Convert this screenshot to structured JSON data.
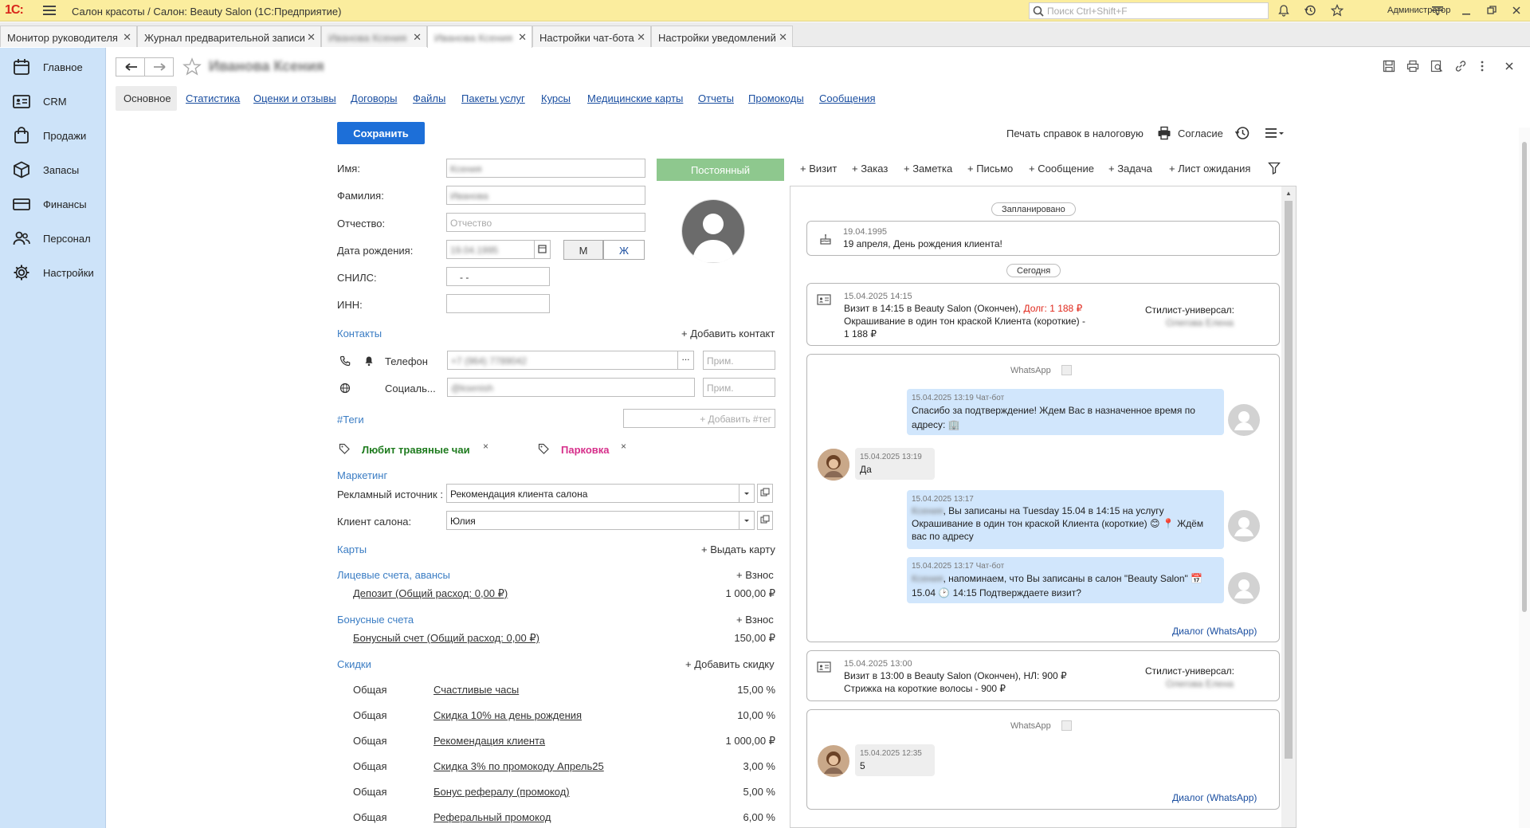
{
  "window": {
    "logo": "1С:",
    "title": "Салон красоты / Салон: Beauty Salon  (1С:Предприятие)",
    "search_placeholder": "Поиск Ctrl+Shift+F",
    "user": "Администратор"
  },
  "tabs": [
    {
      "label": "Монитор руководителя"
    },
    {
      "label": "Журнал предварительной записи"
    },
    {
      "label": "Иванова Ксения"
    },
    {
      "label": "Иванова Ксения"
    },
    {
      "label": "Настройки чат-бота"
    },
    {
      "label": "Настройки уведомлений"
    }
  ],
  "sidebar": {
    "items": [
      {
        "label": "Главное",
        "icon": "calendar-icon"
      },
      {
        "label": "CRM",
        "icon": "contact-card-icon"
      },
      {
        "label": "Продажи",
        "icon": "shopping-bag-icon"
      },
      {
        "label": "Запасы",
        "icon": "box-icon"
      },
      {
        "label": "Финансы",
        "icon": "wallet-icon"
      },
      {
        "label": "Персонал",
        "icon": "people-icon"
      },
      {
        "label": "Настройки",
        "icon": "gear-icon"
      }
    ]
  },
  "form": {
    "title": "Иванова Ксения",
    "subtabs": [
      "Основное",
      "Статистика",
      "Оценки и отзывы",
      "Договоры",
      "Файлы",
      "Пакеты услуг",
      "Курсы",
      "Медицинские карты",
      "Отчеты",
      "Промокоды",
      "Сообщения"
    ],
    "save_label": "Сохранить",
    "status_button": "Постоянный",
    "fields": {
      "name_label": "Имя:",
      "name_value": "Ксения",
      "surname_label": "Фамилия:",
      "surname_value": "Иванова",
      "patronymic_label": "Отчество:",
      "patronymic_placeholder": "Отчество",
      "birth_label": "Дата рождения:",
      "birth_value": "19.04.1995",
      "gender_m": "М",
      "gender_f": "Ж",
      "snils_label": "СНИЛС:",
      "snils_value": "-   -",
      "inn_label": "ИНН:"
    },
    "contacts": {
      "title": "Контакты",
      "add": "+ Добавить контакт",
      "phone_label": "Телефон",
      "phone_value": "+7 (964) 7789042",
      "social_label": "Социаль...",
      "social_value": "@ksenish",
      "note_placeholder": "Прим.",
      "more": "..."
    },
    "tags": {
      "title": "#Теги",
      "add_placeholder": "+ Добавить #тег",
      "items": [
        {
          "label": "Любит травяные чаи",
          "color": "#1e7b1e"
        },
        {
          "label": "Парковка",
          "color": "#d62e8a"
        }
      ],
      "remove": "×"
    },
    "marketing": {
      "title": "Маркетинг",
      "source_label": "Рекламный источник :",
      "source_value": "Рекомендация клиента салона",
      "client_label": "Клиент салона:",
      "client_value": "Юлия"
    },
    "cards": {
      "title": "Карты",
      "add": "+ Выдать карту"
    },
    "accounts": {
      "title": "Лицевые счета, авансы",
      "add": "+ Взнос",
      "item": "Депозит  (Общий расход: 0,00 ₽)",
      "value": "1 000,00 ₽"
    },
    "bonus": {
      "title": "Бонусные счета",
      "add": "+ Взнос",
      "item": "Бонусный счет   (Общий расход: 0,00 ₽)",
      "value": "150,00 ₽"
    },
    "discounts": {
      "title": "Скидки",
      "add": "+ Добавить скидку",
      "rows": [
        {
          "type": "Общая",
          "name": "Счастливые часы",
          "value": "15,00 %"
        },
        {
          "type": "Общая",
          "name": "Скидка 10% на день рождения",
          "value": "10,00 %"
        },
        {
          "type": "Общая",
          "name": "Рекомендация клиента",
          "value": "1 000,00 ₽"
        },
        {
          "type": "Общая",
          "name": "Скидка 3% по промокоду Апрель25",
          "value": "3,00 %"
        },
        {
          "type": "Общая",
          "name": "Бонус рефералу (промокод)",
          "value": "5,00 %"
        },
        {
          "type": "Общая",
          "name": "Реферальный промокод",
          "value": "6,00 %"
        }
      ]
    }
  },
  "right": {
    "print_tax": "Печать справок в налоговую",
    "consent": "Согласие",
    "actions": [
      "+ Визит",
      "+ Заказ",
      "+ Заметка",
      "+ Письмо",
      "+ Сообщение",
      "+ Задача",
      "+ Лист ожидания"
    ],
    "feed": {
      "planned": "Запланировано",
      "today": "Сегодня",
      "birthday": {
        "date": "19.04.1995",
        "text": "19 апреля, День рождения клиента!"
      },
      "visit1": {
        "datetime": "15.04.2025 14:15",
        "line1": "Визит в 14:15 в Beauty Salon (Окончен), ",
        "debt": "Долг:  1 188 ₽",
        "line2": "Окрашивание в один тон краской Клиента (короткие) -",
        "line3": "1 188 ₽",
        "master_label": "Стилист-универсал:",
        "master_name": "Олегова Елена"
      },
      "chat1": {
        "channel": "WhatsApp",
        "messages": [
          {
            "meta": "15.04.2025 13:19 Чат-бот",
            "text": "Спасибо за подтверждение! Ждем Вас в назначенное время по адресу: 🏢"
          },
          {
            "meta": "15.04.2025 13:19",
            "text": "Да"
          },
          {
            "meta": "15.04.2025 13:17",
            "name": "Ксения",
            "text1": ", Вы записаны  на Tuesday 15.04 в 14:15 на услугу",
            "text2": "Окрашивание в один тон краской Клиента (короткие) 😊 📍 Ждём",
            "text3": "вас по адресу"
          },
          {
            "meta": "15.04.2025 13:17 Чат-бот",
            "name": "Ксения",
            "text1": ", напоминаем, что Вы записаны в салон \"Beauty Salon\" 📅",
            "text2": " 15.04  🕑 14:15  Подтверждаете визит?"
          }
        ],
        "dialog": "Диалог (WhatsApp)"
      },
      "visit2": {
        "datetime": "15.04.2025 13:00",
        "line1": "Визит в 13:00 в Beauty Salon (Окончен), НЛ: 900 ₽",
        "line2": "Стрижка на короткие волосы - 900 ₽",
        "master_label": "Стилист-универсал:",
        "master_name": "Олегова Елена"
      },
      "chat2": {
        "channel": "WhatsApp",
        "messages": [
          {
            "meta": "15.04.2025 12:35",
            "text": "5"
          }
        ],
        "dialog": "Диалог (WhatsApp)"
      }
    }
  }
}
